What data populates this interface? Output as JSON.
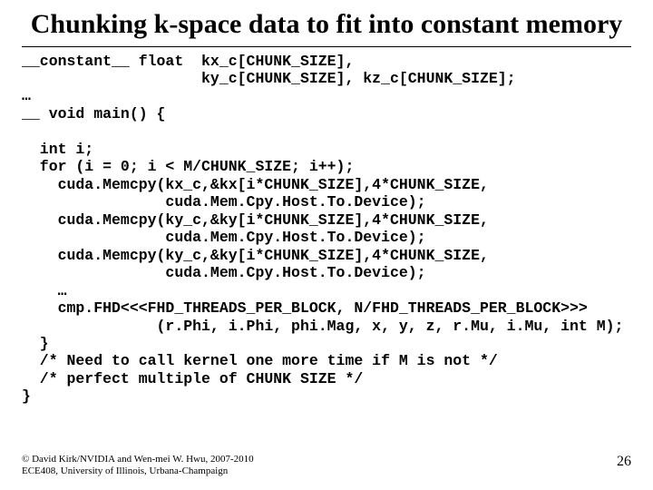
{
  "title": "Chunking k-space data to fit into constant memory",
  "code": "__constant__ float  kx_c[CHUNK_SIZE],\n                    ky_c[CHUNK_SIZE], kz_c[CHUNK_SIZE];\n…\n__ void main() {\n\n  int i;\n  for (i = 0; i < M/CHUNK_SIZE; i++);\n    cuda.Memcpy(kx_c,&kx[i*CHUNK_SIZE],4*CHUNK_SIZE,\n                cuda.Mem.Cpy.Host.To.Device);\n    cuda.Memcpy(ky_c,&ky[i*CHUNK_SIZE],4*CHUNK_SIZE,\n                cuda.Mem.Cpy.Host.To.Device);\n    cuda.Memcpy(ky_c,&ky[i*CHUNK_SIZE],4*CHUNK_SIZE,\n                cuda.Mem.Cpy.Host.To.Device);\n    …\n    cmp.FHD<<<FHD_THREADS_PER_BLOCK, N/FHD_THREADS_PER_BLOCK>>>\n               (r.Phi, i.Phi, phi.Mag, x, y, z, r.Mu, i.Mu, int M);\n  }\n  /* Need to call kernel one more time if M is not */\n  /* perfect multiple of CHUNK SIZE */\n}",
  "footer_line1": "© David Kirk/NVIDIA and Wen-mei W. Hwu, 2007-2010",
  "footer_line2": "ECE408, University of Illinois, Urbana-Champaign",
  "page_number": "26"
}
